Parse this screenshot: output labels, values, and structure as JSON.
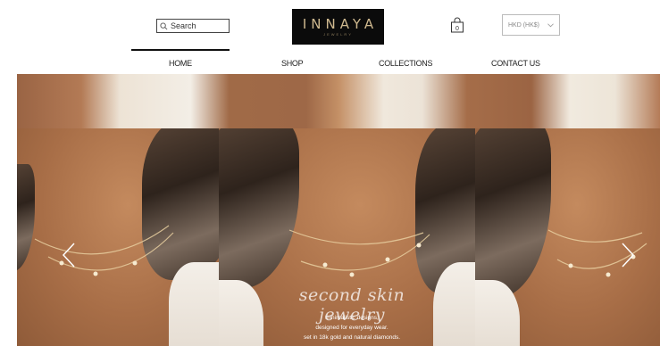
{
  "header": {
    "search_placeholder": "Search",
    "logo_text": "INNAYA",
    "logo_subtext": "JEWELRY",
    "currency_value": "HKD (HK$)"
  },
  "nav": {
    "items": [
      {
        "label": "HOME",
        "active": true
      },
      {
        "label": "SHOP",
        "active": false
      },
      {
        "label": "COLLECTIONS",
        "active": false
      },
      {
        "label": "CONTACT US",
        "active": false
      }
    ]
  },
  "hero": {
    "tagline": "second skin jewelry",
    "description": [
      "minimalistic designs,",
      "designed for everyday wear.",
      "set in 18k gold and natural diamonds."
    ]
  },
  "colors": {
    "logo_bg": "#0b0b0b",
    "logo_gold": "#cfb98f"
  },
  "icons": [
    "search-icon",
    "shopping-bag-icon",
    "chevron-down-icon",
    "chevron-left-icon",
    "chevron-right-icon"
  ]
}
